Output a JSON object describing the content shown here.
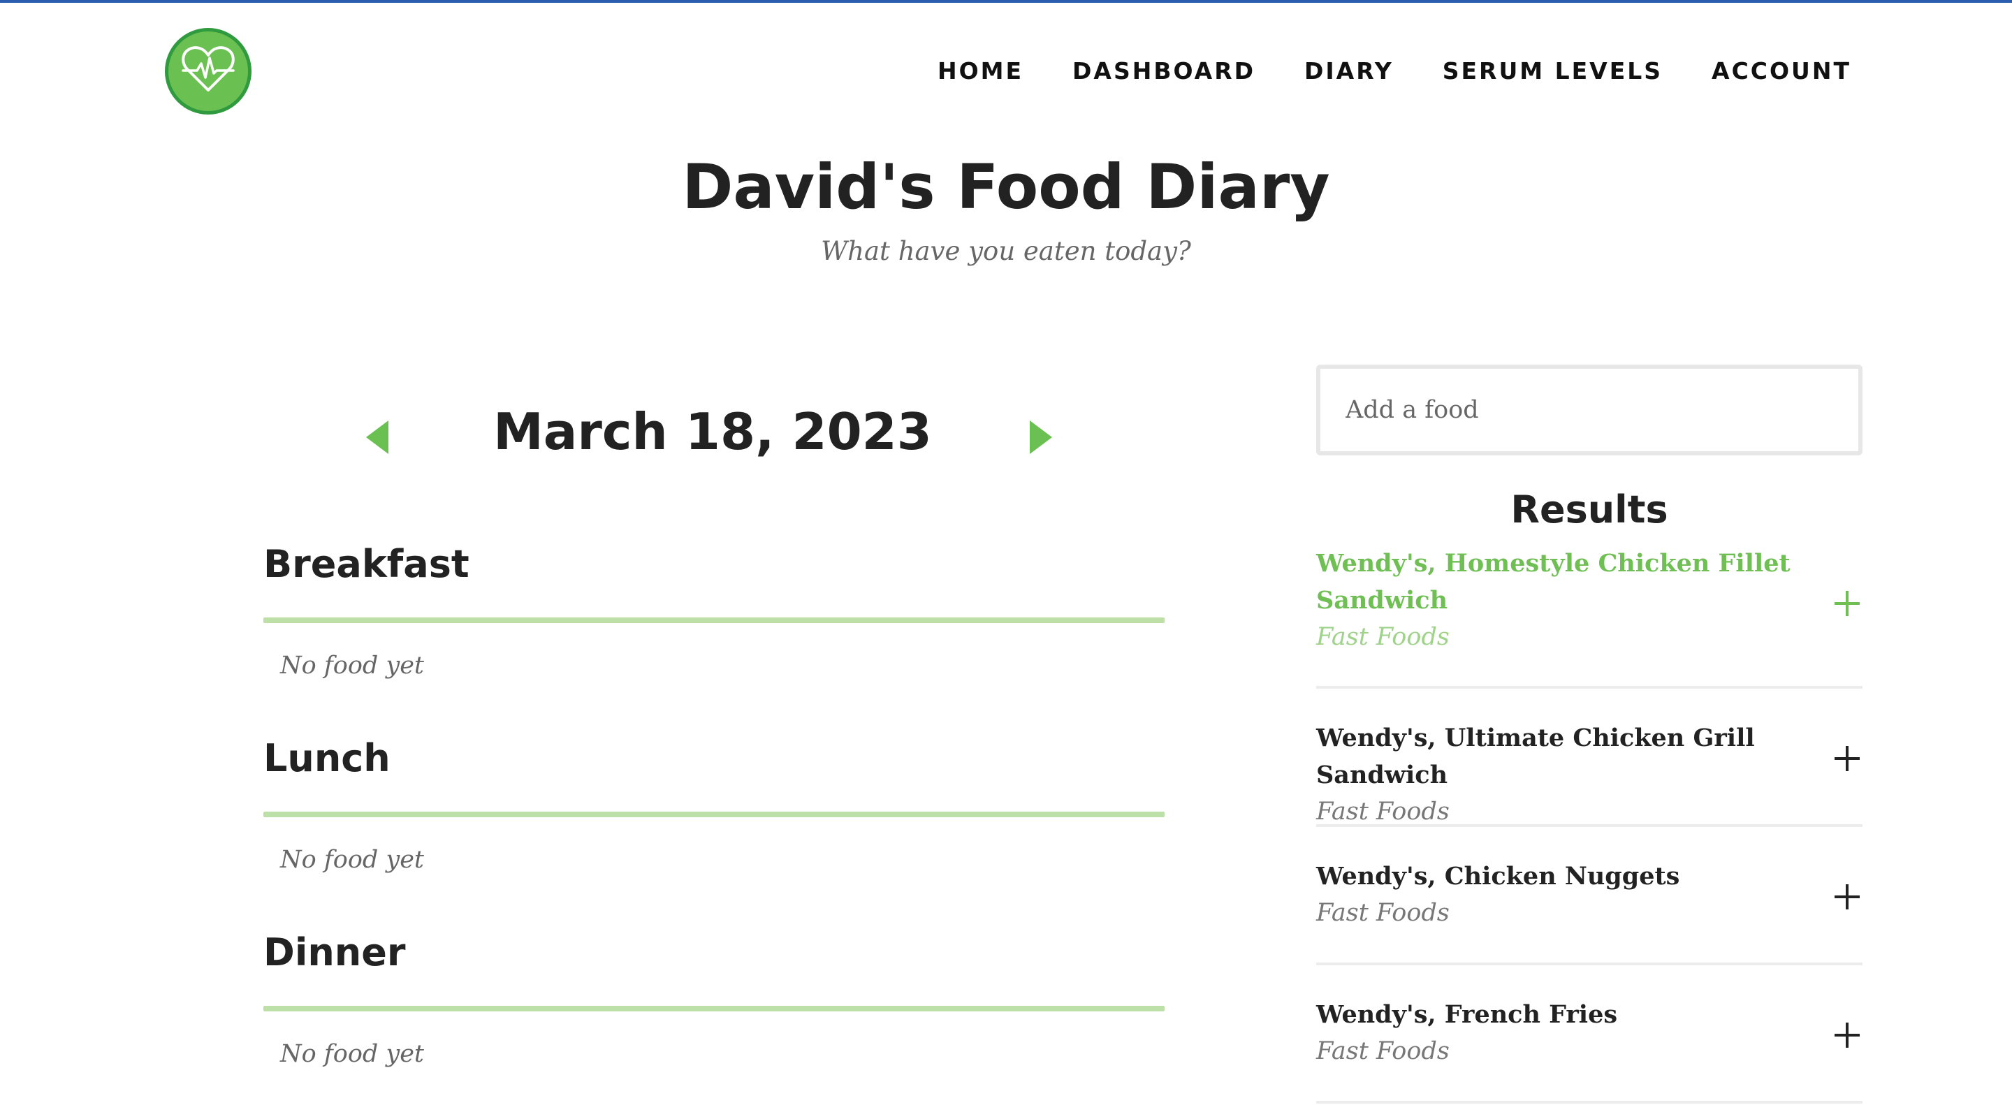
{
  "nav": {
    "items": [
      "HOME",
      "DASHBOARD",
      "DIARY",
      "SERUM LEVELS",
      "ACCOUNT"
    ]
  },
  "header": {
    "title": "David's Food Diary",
    "subtitle": "What have you eaten today?"
  },
  "date_nav": {
    "date": "March 18, 2023"
  },
  "meals": [
    {
      "name": "Breakfast",
      "empty_text": "No food yet"
    },
    {
      "name": "Lunch",
      "empty_text": "No food yet"
    },
    {
      "name": "Dinner",
      "empty_text": "No food yet"
    }
  ],
  "search": {
    "placeholder": "Add a food",
    "results_title": "Results",
    "results": [
      {
        "name": "Wendy's, Homestyle Chicken Fillet Sandwich",
        "category": "Fast Foods"
      },
      {
        "name": "Wendy's, Ultimate Chicken Grill Sandwich",
        "category": "Fast Foods"
      },
      {
        "name": "Wendy's, Chicken Nuggets",
        "category": "Fast Foods"
      },
      {
        "name": "Wendy's, French Fries",
        "category": "Fast Foods"
      }
    ]
  },
  "icons": {
    "logo": "heart-pulse-icon",
    "prev": "triangle-left-icon",
    "next": "triangle-right-icon",
    "add": "plus-icon"
  },
  "colors": {
    "accent_green": "#6ac051",
    "logo_border": "#2f9a3e",
    "meal_rule": "#bde0a8",
    "top_strip": "#2a5db0"
  }
}
